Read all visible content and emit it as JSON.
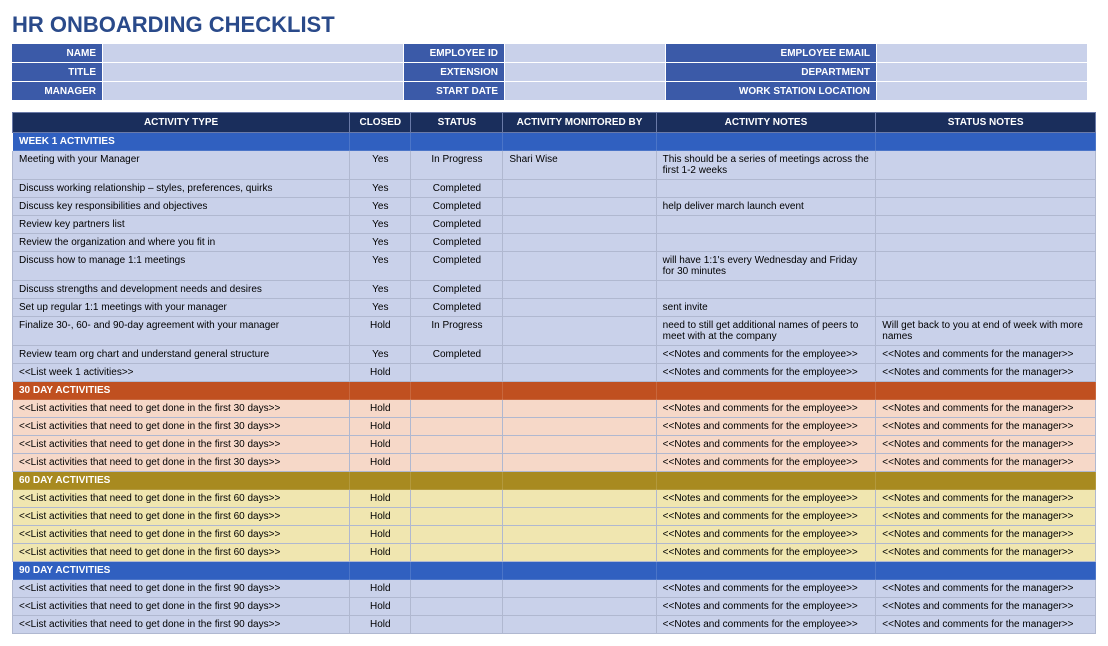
{
  "title": "HR ONBOARDING CHECKLIST",
  "header": {
    "rows": [
      [
        {
          "label": "NAME",
          "value": ""
        },
        {
          "label": "EMPLOYEE ID",
          "value": ""
        },
        {
          "label": "EMPLOYEE EMAIL",
          "value": ""
        }
      ],
      [
        {
          "label": "TITLE",
          "value": ""
        },
        {
          "label": "EXTENSION",
          "value": ""
        },
        {
          "label": "DEPARTMENT",
          "value": ""
        }
      ],
      [
        {
          "label": "MANAGER",
          "value": ""
        },
        {
          "label": "START DATE",
          "value": ""
        },
        {
          "label": "WORK STATION LOCATION",
          "value": ""
        }
      ]
    ]
  },
  "columns": [
    "ACTIVITY TYPE",
    "CLOSED",
    "STATUS",
    "ACTIVITY MONITORED BY",
    "ACTIVITY NOTES",
    "STATUS NOTES"
  ],
  "sections": [
    {
      "label": "WEEK 1 ACTIVITIES",
      "zone": "blue",
      "rows": [
        {
          "activity": "Meeting with your Manager",
          "closed": "Yes",
          "status": "In Progress",
          "monitor": "Shari Wise",
          "anotes": "This should be a series of meetings across the first 1-2 weeks",
          "snotes": ""
        },
        {
          "activity": "Discuss working relationship – styles, preferences, quirks",
          "closed": "Yes",
          "status": "Completed",
          "monitor": "",
          "anotes": "",
          "snotes": ""
        },
        {
          "activity": "Discuss key responsibilities and objectives",
          "closed": "Yes",
          "status": "Completed",
          "monitor": "",
          "anotes": "help deliver march launch event",
          "snotes": ""
        },
        {
          "activity": "Review key partners list",
          "closed": "Yes",
          "status": "Completed",
          "monitor": "",
          "anotes": "",
          "snotes": ""
        },
        {
          "activity": "Review the organization and where you fit in",
          "closed": "Yes",
          "status": "Completed",
          "monitor": "",
          "anotes": "",
          "snotes": ""
        },
        {
          "activity": "Discuss how to manage 1:1 meetings",
          "closed": "Yes",
          "status": "Completed",
          "monitor": "",
          "anotes": "will have 1:1's every Wednesday and Friday for 30 minutes",
          "snotes": ""
        },
        {
          "activity": "Discuss strengths and development needs and desires",
          "closed": "Yes",
          "status": "Completed",
          "monitor": "",
          "anotes": "",
          "snotes": ""
        },
        {
          "activity": "Set up regular 1:1 meetings with your manager",
          "closed": "Yes",
          "status": "Completed",
          "monitor": "",
          "anotes": "sent invite",
          "snotes": ""
        },
        {
          "activity": "Finalize 30-, 60- and 90-day agreement with your manager",
          "closed": "Hold",
          "status": "In Progress",
          "monitor": "",
          "anotes": "need to still get additional names of peers to meet with at the company",
          "snotes": "Will get back to you at end of week with more names"
        },
        {
          "activity": "Review team org chart and understand general structure",
          "closed": "Yes",
          "status": "Completed",
          "monitor": "",
          "anotes": "<<Notes and comments for the employee>>",
          "snotes": "<<Notes and comments for the manager>>"
        },
        {
          "activity": "<<List week 1 activities>>",
          "closed": "Hold",
          "status": "",
          "monitor": "",
          "anotes": "<<Notes and comments for the employee>>",
          "snotes": "<<Notes and comments for the manager>>"
        }
      ]
    },
    {
      "label": "30 DAY ACTIVITIES",
      "zone": "orange",
      "rows": [
        {
          "activity": "<<List activities that need to get done in the first 30 days>>",
          "closed": "Hold",
          "status": "",
          "monitor": "",
          "anotes": "<<Notes and comments for the employee>>",
          "snotes": "<<Notes and comments for the manager>>"
        },
        {
          "activity": "<<List activities that need to get done in the first 30 days>>",
          "closed": "Hold",
          "status": "",
          "monitor": "",
          "anotes": "<<Notes and comments for the employee>>",
          "snotes": "<<Notes and comments for the manager>>"
        },
        {
          "activity": "<<List activities that need to get done in the first 30 days>>",
          "closed": "Hold",
          "status": "",
          "monitor": "",
          "anotes": "<<Notes and comments for the employee>>",
          "snotes": "<<Notes and comments for the manager>>"
        },
        {
          "activity": "<<List activities that need to get done in the first 30 days>>",
          "closed": "Hold",
          "status": "",
          "monitor": "",
          "anotes": "<<Notes and comments for the employee>>",
          "snotes": "<<Notes and comments for the manager>>"
        }
      ]
    },
    {
      "label": "60 DAY ACTIVITIES",
      "zone": "olive",
      "rows": [
        {
          "activity": "<<List activities that need to get done in the first 60 days>>",
          "closed": "Hold",
          "status": "",
          "monitor": "",
          "anotes": "<<Notes and comments for the employee>>",
          "snotes": "<<Notes and comments for the manager>>"
        },
        {
          "activity": "<<List activities that need to get done in the first 60 days>>",
          "closed": "Hold",
          "status": "",
          "monitor": "",
          "anotes": "<<Notes and comments for the employee>>",
          "snotes": "<<Notes and comments for the manager>>"
        },
        {
          "activity": "<<List activities that need to get done in the first 60 days>>",
          "closed": "Hold",
          "status": "",
          "monitor": "",
          "anotes": "<<Notes and comments for the employee>>",
          "snotes": "<<Notes and comments for the manager>>"
        },
        {
          "activity": "<<List activities that need to get done in the first 60 days>>",
          "closed": "Hold",
          "status": "",
          "monitor": "",
          "anotes": "<<Notes and comments for the employee>>",
          "snotes": "<<Notes and comments for the manager>>"
        }
      ]
    },
    {
      "label": "90 DAY ACTIVITIES",
      "zone": "blue2",
      "rows": [
        {
          "activity": "<<List activities that need to get done in the first 90 days>>",
          "closed": "Hold",
          "status": "",
          "monitor": "",
          "anotes": "<<Notes and comments for the employee>>",
          "snotes": "<<Notes and comments for the manager>>"
        },
        {
          "activity": "<<List activities that need to get done in the first 90 days>>",
          "closed": "Hold",
          "status": "",
          "monitor": "",
          "anotes": "<<Notes and comments for the employee>>",
          "snotes": "<<Notes and comments for the manager>>"
        },
        {
          "activity": "<<List activities that need to get done in the first 90 days>>",
          "closed": "Hold",
          "status": "",
          "monitor": "",
          "anotes": "<<Notes and comments for the employee>>",
          "snotes": "<<Notes and comments for the manager>>"
        }
      ]
    }
  ]
}
